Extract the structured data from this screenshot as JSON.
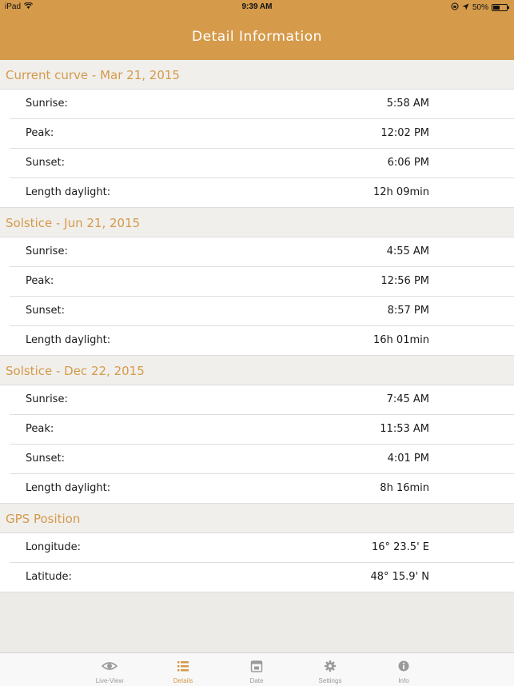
{
  "status_bar": {
    "device": "iPad",
    "time": "9:39 AM",
    "battery": "50%"
  },
  "header": {
    "title": "Detail Information"
  },
  "sections": [
    {
      "title": "Current curve - Mar 21, 2015",
      "rows": [
        {
          "label": "Sunrise:",
          "value": "5:58 AM"
        },
        {
          "label": "Peak:",
          "value": "12:02 PM"
        },
        {
          "label": "Sunset:",
          "value": "6:06 PM"
        },
        {
          "label": "Length daylight:",
          "value": "12h 09min"
        }
      ]
    },
    {
      "title": "Solstice - Jun 21, 2015",
      "rows": [
        {
          "label": "Sunrise:",
          "value": "4:55 AM"
        },
        {
          "label": "Peak:",
          "value": "12:56 PM"
        },
        {
          "label": "Sunset:",
          "value": "8:57 PM"
        },
        {
          "label": "Length daylight:",
          "value": "16h 01min"
        }
      ]
    },
    {
      "title": "Solstice - Dec 22, 2015",
      "rows": [
        {
          "label": "Sunrise:",
          "value": "7:45 AM"
        },
        {
          "label": "Peak:",
          "value": "11:53 AM"
        },
        {
          "label": "Sunset:",
          "value": "4:01 PM"
        },
        {
          "label": "Length daylight:",
          "value": "8h 16min"
        }
      ]
    },
    {
      "title": "GPS Position",
      "rows": [
        {
          "label": "Longitude:",
          "value": "16° 23.5'  E"
        },
        {
          "label": "Latitude:",
          "value": "48° 15.9'  N"
        }
      ]
    }
  ],
  "tabs": [
    {
      "label": "Live-View",
      "icon": "eye-icon"
    },
    {
      "label": "Details",
      "icon": "list-icon"
    },
    {
      "label": "Date",
      "icon": "calendar-icon"
    },
    {
      "label": "Settings",
      "icon": "gear-icon"
    },
    {
      "label": "Info",
      "icon": "info-icon"
    }
  ],
  "colors": {
    "accent": "#d59a4a",
    "header_text": "#ffffff",
    "tab_inactive": "#9a9a9a"
  }
}
